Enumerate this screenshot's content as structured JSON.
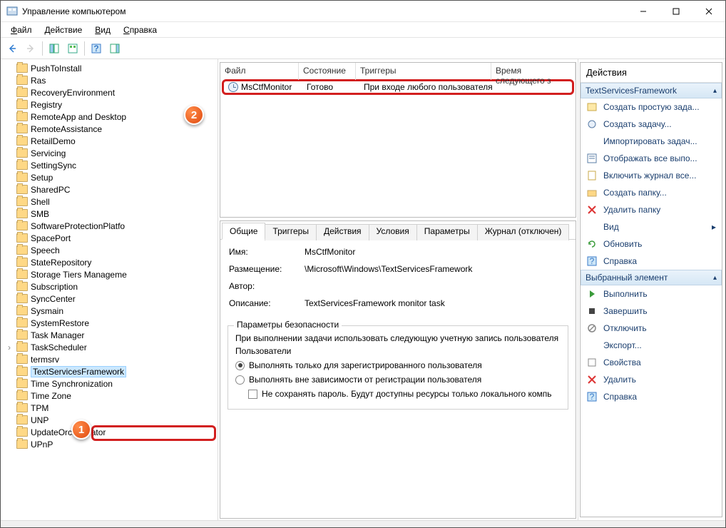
{
  "title": "Управление компьютером",
  "menu": {
    "file": "Файл",
    "action": "Действие",
    "view": "Вид",
    "help": "Справка"
  },
  "tree": [
    "PushToInstall",
    "Ras",
    "RecoveryEnvironment",
    "Registry",
    "RemoteApp and Desktop",
    "RemoteAssistance",
    "RetailDemo",
    "Servicing",
    "SettingSync",
    "Setup",
    "SharedPC",
    "Shell",
    "SMB",
    "SoftwareProtectionPlatfo",
    "SpacePort",
    "Speech",
    "StateRepository",
    "Storage Tiers Manageme",
    "Subscription",
    "SyncCenter",
    "Sysmain",
    "SystemRestore",
    "Task Manager",
    "TaskScheduler",
    "termsrv",
    "TextServicesFramework",
    "Time Synchronization",
    "Time Zone",
    "TPM",
    "UNP",
    "UpdateOrchestrator",
    "UPnP"
  ],
  "selected_tree": "TextServicesFramework",
  "columns": {
    "file": "Файл",
    "state": "Состояние",
    "triggers": "Триггеры",
    "next": "Время следующего з"
  },
  "row": {
    "name": "MsCtfMonitor",
    "state": "Готово",
    "trigger": "При входе любого пользователя"
  },
  "tabs": {
    "general": "Общие",
    "triggers": "Триггеры",
    "actions": "Действия",
    "conditions": "Условия",
    "params": "Параметры",
    "log": "Журнал (отключен)"
  },
  "form": {
    "name_lbl": "Имя:",
    "name_val": "MsCtfMonitor",
    "loc_lbl": "Размещение:",
    "loc_val": "\\Microsoft\\Windows\\TextServicesFramework",
    "author_lbl": "Автор:",
    "desc_lbl": "Описание:",
    "desc_val": "TextServicesFramework monitor task"
  },
  "sec": {
    "legend": "Параметры безопасности",
    "line1": "При выполнении задачи использовать следующую учетную запись пользователя",
    "users": "Пользователи",
    "opt1": "Выполнять только для зарегистрированного пользователя",
    "opt2": "Выполнять вне зависимости от регистрации пользователя",
    "chk": "Не сохранять пароль. Будут доступны ресурсы только локального компь"
  },
  "actions_title": "Действия",
  "group1": "TextServicesFramework",
  "a": {
    "create_basic": "Создать простую зада...",
    "create": "Создать задачу...",
    "import": "Импортировать задач...",
    "show_all": "Отображать все выпо...",
    "enable_log": "Включить журнал все...",
    "new_folder": "Создать папку...",
    "del_folder": "Удалить папку",
    "view": "Вид",
    "refresh": "Обновить",
    "help": "Справка"
  },
  "group2": "Выбранный элемент",
  "b": {
    "run": "Выполнить",
    "end": "Завершить",
    "disable": "Отключить",
    "export": "Экспорт...",
    "props": "Свойства",
    "delete": "Удалить",
    "help": "Справка"
  },
  "badge1": "1",
  "badge2": "2"
}
